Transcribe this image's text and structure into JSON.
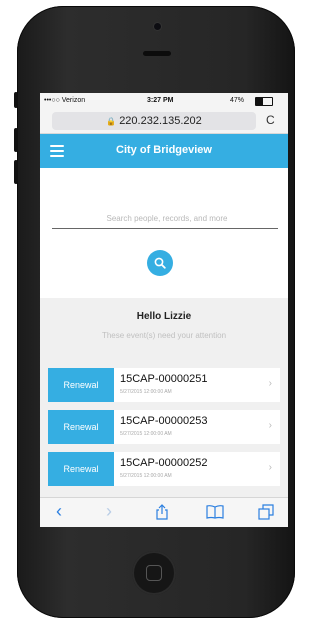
{
  "status": {
    "carrier": "•••○○ Verizon",
    "time": "3:27 PM",
    "battery": "47%"
  },
  "browser": {
    "url": "220.232.135.202",
    "reload_glyph": "C"
  },
  "app": {
    "title": "City of Bridgeview"
  },
  "search": {
    "placeholder": "Search people, records, and more"
  },
  "greeting": {
    "hello": "Hello Lizzie",
    "subtitle": "These event(s) need your attention"
  },
  "records": [
    {
      "action": "Renewal",
      "id": "15CAP-00000251",
      "date": "5/27/2015 12:00:00 AM"
    },
    {
      "action": "Renewal",
      "id": "15CAP-00000253",
      "date": "5/27/2015 12:00:00 AM"
    },
    {
      "action": "Renewal",
      "id": "15CAP-00000252",
      "date": "5/27/2015 12:00:00 AM"
    }
  ],
  "toolbar": {
    "back": "‹",
    "forward": "›"
  },
  "colors": {
    "accent": "#35aee2",
    "ios_blue": "#2b7fe0"
  }
}
